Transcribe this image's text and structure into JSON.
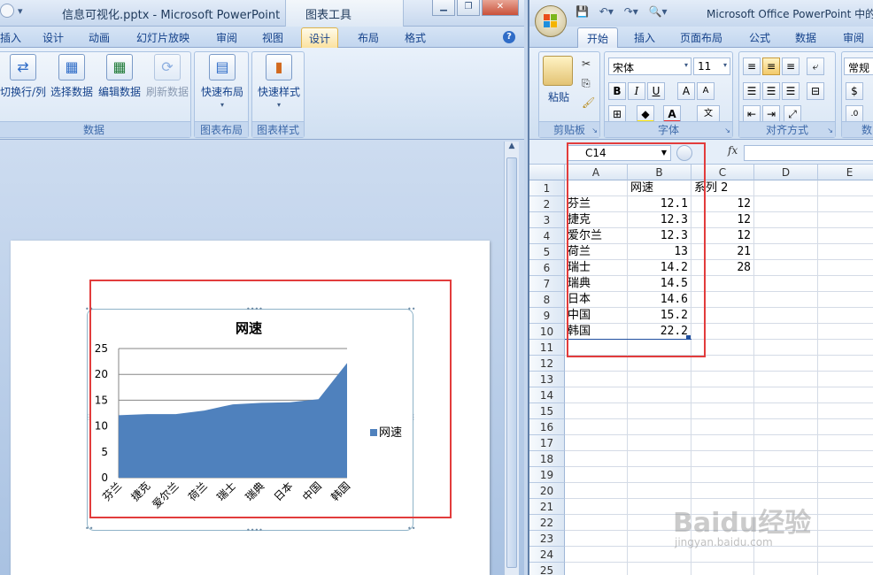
{
  "ppt": {
    "doc_title": "信息可视化.pptx - Microsoft PowerPoint",
    "context_tool": "图表工具",
    "tabs": [
      "插入",
      "设计",
      "动画",
      "幻灯片放映",
      "审阅",
      "视图",
      "设计",
      "布局",
      "格式"
    ],
    "active_tab": "设计",
    "ribbon": {
      "data_group": {
        "label": "数据",
        "buttons": [
          "切换行/列",
          "选择数据",
          "编辑数据",
          "刷新数据"
        ]
      },
      "layout_group": {
        "label": "图表布局",
        "button": "快速布局"
      },
      "style_group": {
        "label": "图表样式",
        "button": "快速样式"
      }
    },
    "icons": [
      "office-orb-icon",
      "undo-icon",
      "redo-icon",
      "close-icon",
      "help-icon"
    ]
  },
  "chart_data": {
    "type": "area",
    "title": "网速",
    "categories": [
      "芬兰",
      "捷克",
      "爱尔兰",
      "荷兰",
      "瑞士",
      "瑞典",
      "日本",
      "中国",
      "韩国"
    ],
    "series": [
      {
        "name": "网速",
        "values": [
          12.1,
          12.3,
          12.3,
          13,
          14.2,
          14.5,
          14.6,
          15.2,
          22.2
        ],
        "color": "#4f81bd"
      }
    ],
    "ylim": [
      0,
      25
    ],
    "yticks": [
      0,
      5,
      10,
      15,
      20,
      25
    ],
    "grid": true,
    "legend": "right"
  },
  "excel": {
    "doc_title": "Microsoft Office PowerPoint 中的",
    "tabs": [
      "开始",
      "插入",
      "页面布局",
      "公式",
      "数据",
      "审阅"
    ],
    "active_tab": "开始",
    "ribbon": {
      "clipboard": {
        "label": "剪贴板",
        "paste": "粘贴"
      },
      "font": {
        "label": "字体",
        "font_name": "宋体",
        "font_size": "11"
      },
      "alignment": {
        "label": "对齐方式"
      },
      "number": {
        "label": "数",
        "format": "常规"
      }
    },
    "name_box": "C14",
    "fx": "fx",
    "columns": [
      "A",
      "B",
      "C",
      "D",
      "E"
    ],
    "rows": [
      "1",
      "2",
      "3",
      "4",
      "5",
      "6",
      "7",
      "8",
      "9",
      "10",
      "11",
      "12",
      "13",
      "14",
      "15",
      "16",
      "17",
      "18",
      "19",
      "20",
      "21",
      "22",
      "23",
      "24",
      "25"
    ],
    "cells": [
      [
        "",
        "网速",
        "系列 2"
      ],
      [
        "芬兰",
        "12.1",
        "12"
      ],
      [
        "捷克",
        "12.3",
        "12"
      ],
      [
        "爱尔兰",
        "12.3",
        "12"
      ],
      [
        "荷兰",
        "13",
        "21"
      ],
      [
        "瑞士",
        "14.2",
        "28"
      ],
      [
        "瑞典",
        "14.5",
        ""
      ],
      [
        "日本",
        "14.6",
        ""
      ],
      [
        "中国",
        "15.2",
        ""
      ],
      [
        "韩国",
        "22.2",
        ""
      ]
    ]
  },
  "watermark": {
    "text": "Baidu经验",
    "sub": "jingyan.baidu.com"
  },
  "colors": {
    "accent_red": "#e23c3c",
    "series_blue": "#4f81bd",
    "ribbon_blue": "#c2d6ef"
  }
}
